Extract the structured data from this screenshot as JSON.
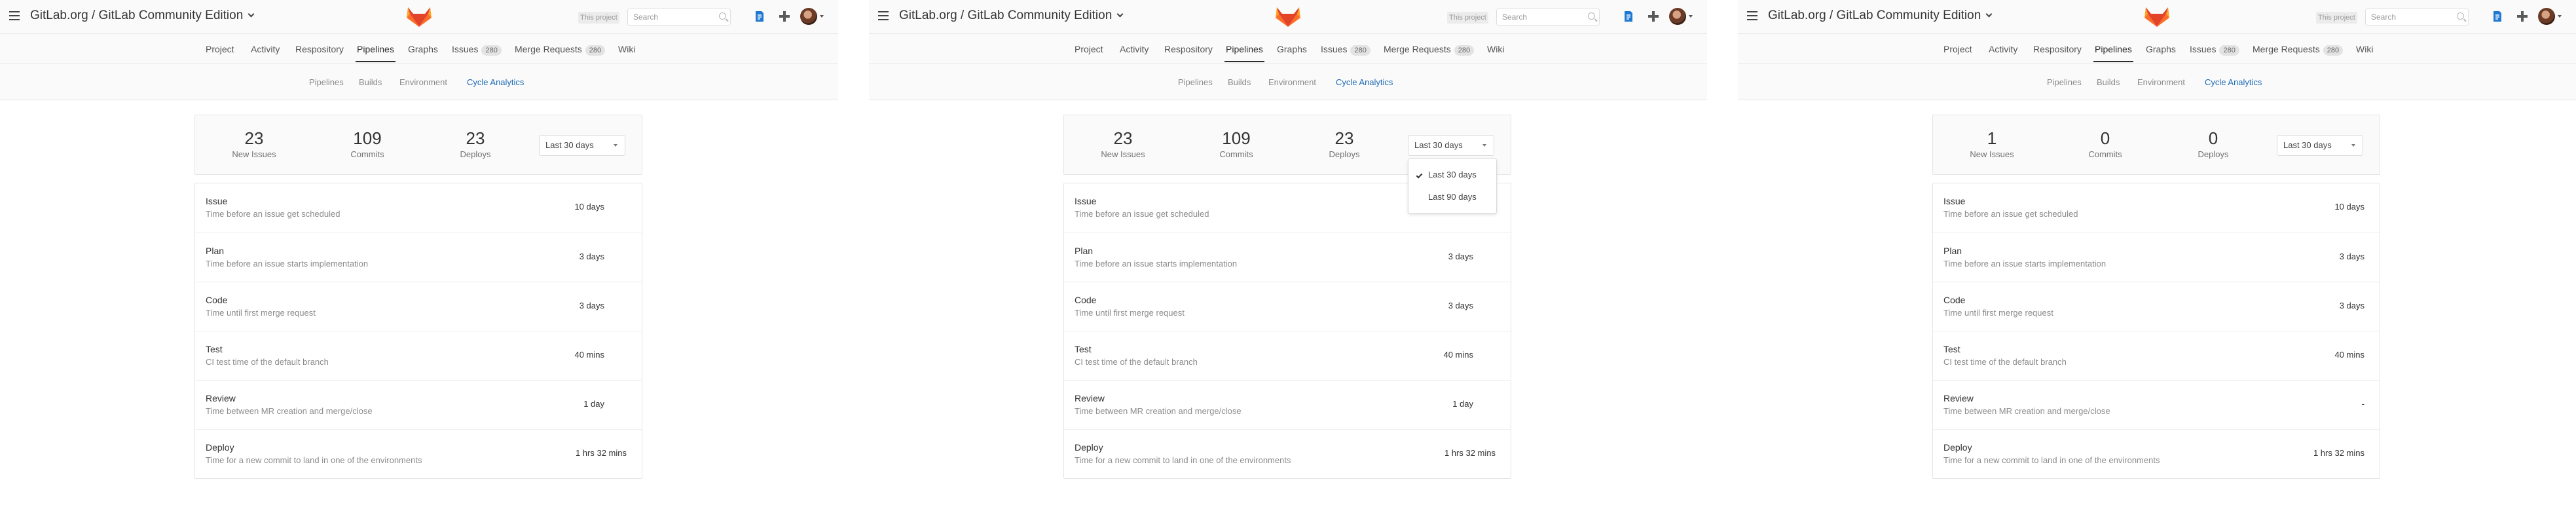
{
  "header": {
    "title": "GitLab.org / GitLab Community Edition",
    "scope_label": "This project",
    "search_placeholder": "Search"
  },
  "nav": [
    {
      "label": "Project"
    },
    {
      "label": "Activity"
    },
    {
      "label": "Respository"
    },
    {
      "label": "Pipelines"
    },
    {
      "label": "Graphs"
    },
    {
      "label": "Issues",
      "count": "280"
    },
    {
      "label": "Merge Requests",
      "count": "280"
    },
    {
      "label": "Wiki"
    }
  ],
  "subnav": [
    {
      "label": "Pipelines"
    },
    {
      "label": "Builds"
    },
    {
      "label": "Environment"
    },
    {
      "label": "Cycle Analytics"
    }
  ],
  "colors": {
    "active_subnav": "#1b69b6",
    "logo_orange": "#e24329",
    "logo_light": "#fca326"
  },
  "panels": [
    {
      "stats": [
        {
          "value": "23",
          "label": "New Issues"
        },
        {
          "value": "109",
          "label": "Commits"
        },
        {
          "value": "23",
          "label": "Deploys"
        }
      ],
      "range": "Last 30 days",
      "stages": [
        {
          "name": "Issue",
          "desc": "Time before an issue get scheduled",
          "value": "10 days"
        },
        {
          "name": "Plan",
          "desc": "Time before an issue starts implementation",
          "value": "3 days"
        },
        {
          "name": "Code",
          "desc": "Time until first merge request",
          "value": "3 days"
        },
        {
          "name": "Test",
          "desc": "CI test time of the default branch",
          "value": "40 mins"
        },
        {
          "name": "Review",
          "desc": "Time between MR creation and merge/close",
          "value": "1 day"
        },
        {
          "name": "Deploy",
          "desc": "Time for a new commit to land in one of the environments",
          "value": "1 hrs 32 mins"
        }
      ]
    },
    {
      "stats": [
        {
          "value": "23",
          "label": "New Issues"
        },
        {
          "value": "109",
          "label": "Commits"
        },
        {
          "value": "23",
          "label": "Deploys"
        }
      ],
      "range": "Last 30 days",
      "menu": [
        "Last 30 days",
        "Last 90 days"
      ],
      "stages": [
        {
          "name": "Issue",
          "desc": "Time before an issue get scheduled",
          "value": ""
        },
        {
          "name": "Plan",
          "desc": "Time before an issue starts implementation",
          "value": "3 days"
        },
        {
          "name": "Code",
          "desc": "Time until first merge request",
          "value": "3 days"
        },
        {
          "name": "Test",
          "desc": "CI test time of the default branch",
          "value": "40 mins"
        },
        {
          "name": "Review",
          "desc": "Time between MR creation and merge/close",
          "value": "1 day"
        },
        {
          "name": "Deploy",
          "desc": "Time for a new commit to land in one of the environments",
          "value": "1 hrs 32 mins"
        }
      ]
    },
    {
      "stats": [
        {
          "value": "1",
          "label": "New Issues"
        },
        {
          "value": "0",
          "label": "Commits"
        },
        {
          "value": "0",
          "label": "Deploys"
        }
      ],
      "range": "Last 30 days",
      "stages": [
        {
          "name": "Issue",
          "desc": "Time before an issue get scheduled",
          "value": "10 days"
        },
        {
          "name": "Plan",
          "desc": "Time before an issue starts implementation",
          "value": "3 days"
        },
        {
          "name": "Code",
          "desc": "Time until first merge request",
          "value": "3 days"
        },
        {
          "name": "Test",
          "desc": "CI test time of the default branch",
          "value": "40 mins"
        },
        {
          "name": "Review",
          "desc": "Time between MR creation and merge/close",
          "value": "-"
        },
        {
          "name": "Deploy",
          "desc": "Time for a new commit to land in one of the environments",
          "value": "1 hrs 32 mins"
        }
      ]
    }
  ]
}
